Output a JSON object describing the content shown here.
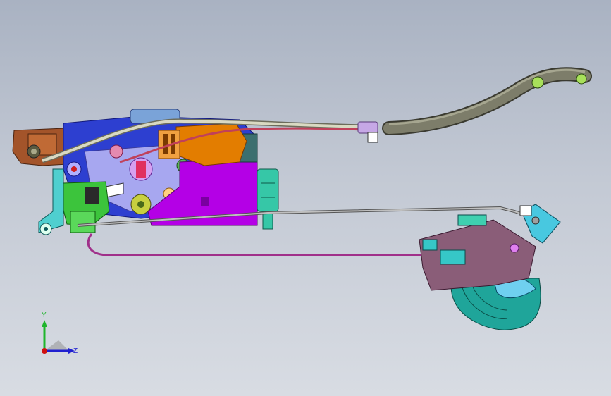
{
  "viewport": {
    "background_top": "#a9b2c2",
    "background_bottom": "#d8dce3"
  },
  "model": {
    "colors": {
      "housing_blue": "#2d3fd0",
      "plate_purple": "#b400e6",
      "bracket_orange": "#e37d00",
      "latch_green": "#3cc43c",
      "connector_teal": "#36c7a7",
      "cable_white": "#d9d9c2",
      "cable_red": "#c0405a",
      "hose_olive": "#7d7d6a",
      "rod_gray": "#9a9a9a",
      "handle_mauve": "#8a5d78",
      "handle_dome": "#1fa59a",
      "copper_bracket": "#a3542a",
      "wire_magenta": "#a0308a"
    }
  },
  "triad": {
    "y_label": "Y",
    "z_label": "Z",
    "y_color": "#1fb52c",
    "z_color": "#2020d0",
    "origin_color": "#d01010"
  }
}
